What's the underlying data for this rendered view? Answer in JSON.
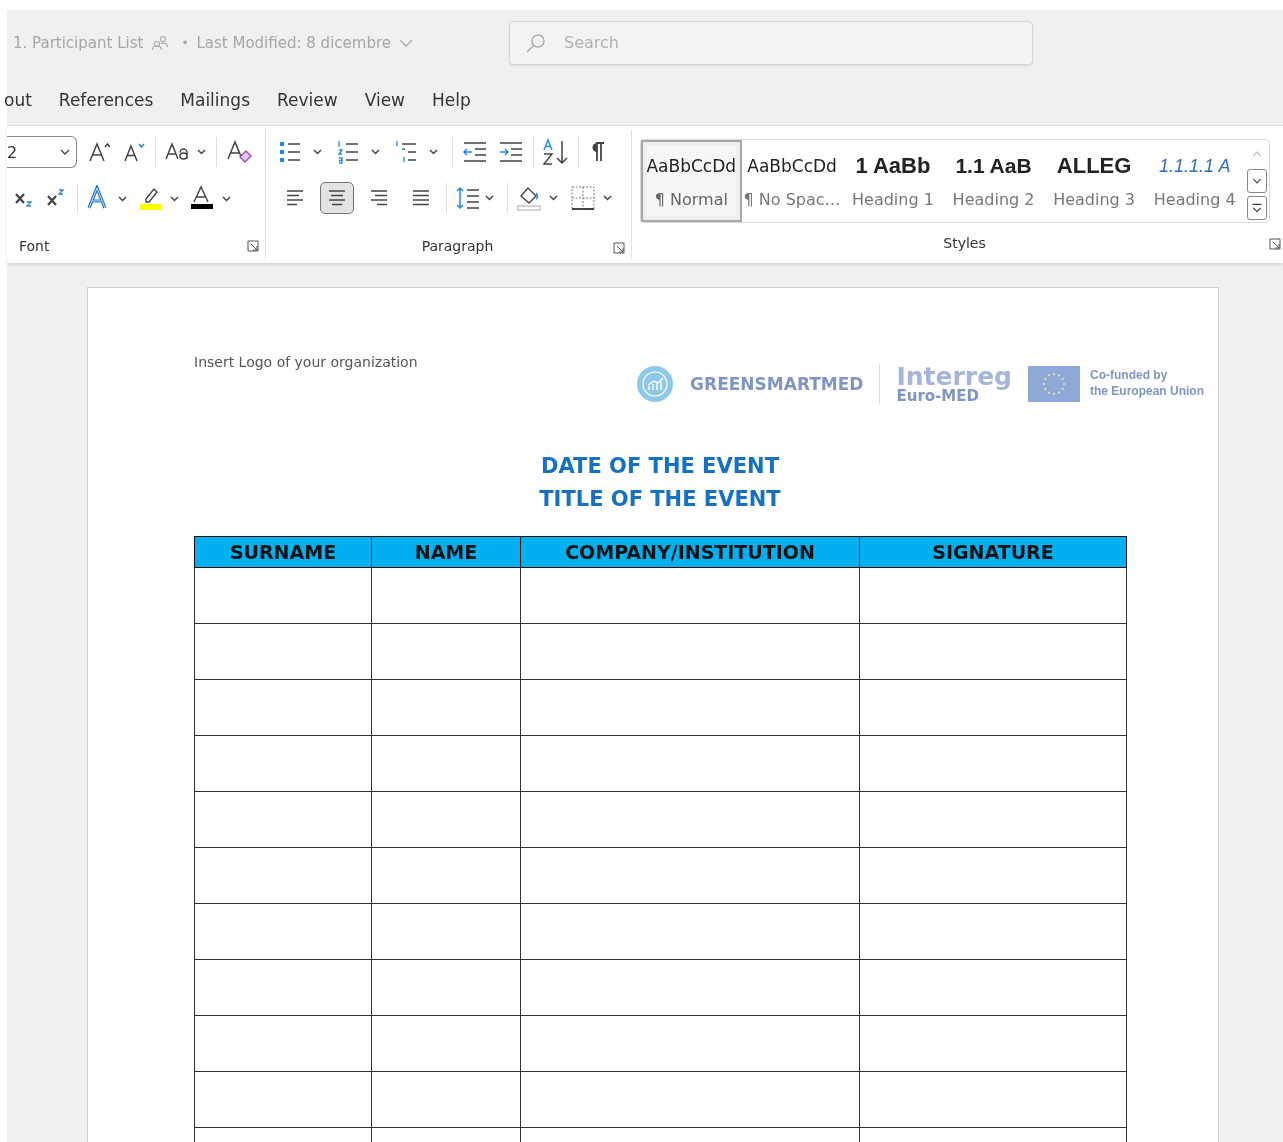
{
  "title_bar": {
    "document_title": "1. Participant List",
    "separator": "•",
    "last_modified": "Last Modified: 8 dicembre",
    "search": {
      "placeholder": "Search"
    }
  },
  "menu_tabs": [
    {
      "label": "out"
    },
    {
      "label": "References"
    },
    {
      "label": "Mailings"
    },
    {
      "label": "Review"
    },
    {
      "label": "View"
    },
    {
      "label": "Help"
    }
  ],
  "ribbon": {
    "font": {
      "font_size": "2",
      "label": "Font"
    },
    "paragraph": {
      "label": "Paragraph",
      "alignment": [
        {
          "kind": "left",
          "selected": false
        },
        {
          "kind": "center",
          "selected": true
        },
        {
          "kind": "right",
          "selected": false
        },
        {
          "kind": "justify",
          "selected": false
        }
      ]
    },
    "styles": {
      "label": "Styles",
      "items": [
        {
          "kind": "normal",
          "preview": "AaBbCcDd",
          "name": "¶ Normal",
          "selected": true
        },
        {
          "kind": "nospace",
          "preview": "AaBbCcDd",
          "name": "¶ No Spac…",
          "selected": false
        },
        {
          "kind": "heading1",
          "preview": "1  AaBb",
          "name": "Heading 1",
          "selected": false
        },
        {
          "kind": "heading2",
          "preview": "1.1  AaB",
          "name": "Heading 2",
          "selected": false
        },
        {
          "kind": "heading3",
          "preview": "ALLEG",
          "name": "Heading 3",
          "selected": false
        },
        {
          "kind": "heading4",
          "preview": "1.1.1.1  A",
          "name": "Heading 4",
          "selected": false
        }
      ]
    }
  },
  "document": {
    "header_note": "Insert Logo of your organization",
    "logos": {
      "project": "GREENSMARTMED",
      "programme": "Interreg",
      "programme_sub": "Euro-MED",
      "funding_line_1": "Co-funded by",
      "funding_line_2": "the European Union"
    },
    "titles": [
      "DATE OF THE EVENT",
      "TITLE OF THE EVENT"
    ],
    "table": {
      "columns": [
        "SURNAME",
        "NAME",
        "COMPANY/INSTITUTION",
        "SIGNATURE"
      ],
      "rows": [
        {
          "kind": "blank"
        },
        {
          "kind": "blank"
        },
        {
          "kind": "blank"
        },
        {
          "kind": "blank"
        },
        {
          "kind": "blank"
        },
        {
          "kind": "blank"
        },
        {
          "kind": "blank"
        },
        {
          "kind": "blank"
        },
        {
          "kind": "blank"
        },
        {
          "kind": "blank"
        },
        {
          "kind": "blank"
        }
      ]
    }
  }
}
